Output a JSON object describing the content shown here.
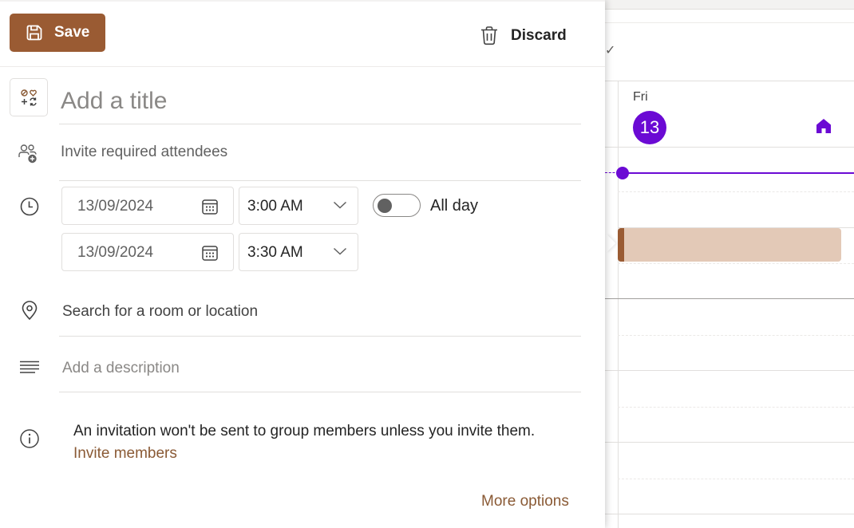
{
  "toolbar": {
    "save_label": "Save",
    "discard_label": "Discard"
  },
  "form": {
    "title_placeholder": "Add a title",
    "attendees_placeholder": "Invite required attendees",
    "start_date": "13/09/2024",
    "start_time": "3:00 AM",
    "end_date": "13/09/2024",
    "end_time": "3:30 AM",
    "all_day_label": "All day",
    "all_day_on": false,
    "location_placeholder": "Search for a room or location",
    "description_placeholder": "Add a description",
    "info_text": "An invitation won't be sent to group members unless you invite them.",
    "invite_members_link": "Invite members",
    "more_options_link": "More options"
  },
  "icons": {
    "save": "save-icon",
    "discard": "trash-icon",
    "category": "category-icon",
    "attendees": "people-add-icon",
    "time": "clock-icon",
    "date_picker": "calendar-icon",
    "dropdown": "chevron-down-icon",
    "location": "location-icon",
    "description": "text-align-icon",
    "info": "info-icon",
    "home": "home-icon",
    "check": "check-icon"
  },
  "calendar": {
    "day_name": "Fri",
    "day_number": "13"
  },
  "colors": {
    "accent_brown": "#9a5b33",
    "link_brown": "#8a5a35",
    "event_fill": "#e3c9b7",
    "today_purple": "#6b0ad4"
  }
}
